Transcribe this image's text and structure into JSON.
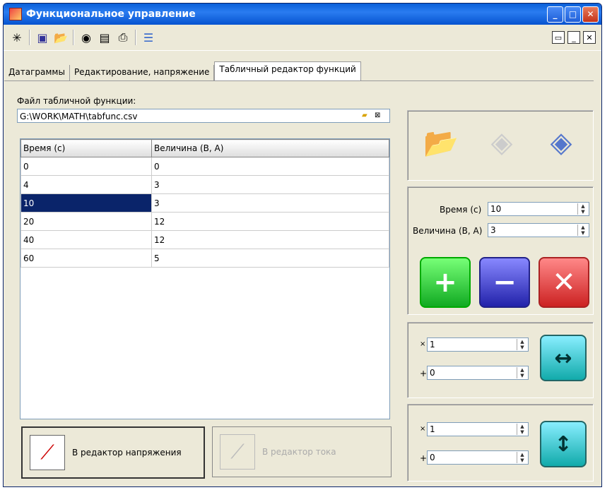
{
  "window": {
    "title": "Функциональное управление"
  },
  "tabs": [
    {
      "label": "Датаграммы"
    },
    {
      "label": "Редактирование, напряжение"
    },
    {
      "label": "Табличный редактор функций"
    }
  ],
  "file": {
    "label": "Файл табличной функции:",
    "path": "G:\\WORK\\MATH\\tabfunc.csv"
  },
  "table": {
    "headers": [
      "Время (с)",
      "Величина (В, А)"
    ],
    "rows": [
      [
        "0",
        "0"
      ],
      [
        "4",
        "3"
      ],
      [
        "10",
        "3"
      ],
      [
        "20",
        "12"
      ],
      [
        "40",
        "12"
      ],
      [
        "60",
        "5"
      ]
    ]
  },
  "editor": {
    "time_label": "Время (с)",
    "time_value": "10",
    "value_label": "Величина (В, А)",
    "value_value": "3"
  },
  "scale_h": {
    "mul_sign": "×",
    "mul_value": "1",
    "add_sign": "+",
    "add_value": "0"
  },
  "scale_v": {
    "mul_sign": "×",
    "mul_value": "1",
    "add_sign": "+",
    "add_value": "0"
  },
  "buttons": {
    "to_voltage": "В редактор напряжения",
    "to_current": "В редактор тока"
  }
}
